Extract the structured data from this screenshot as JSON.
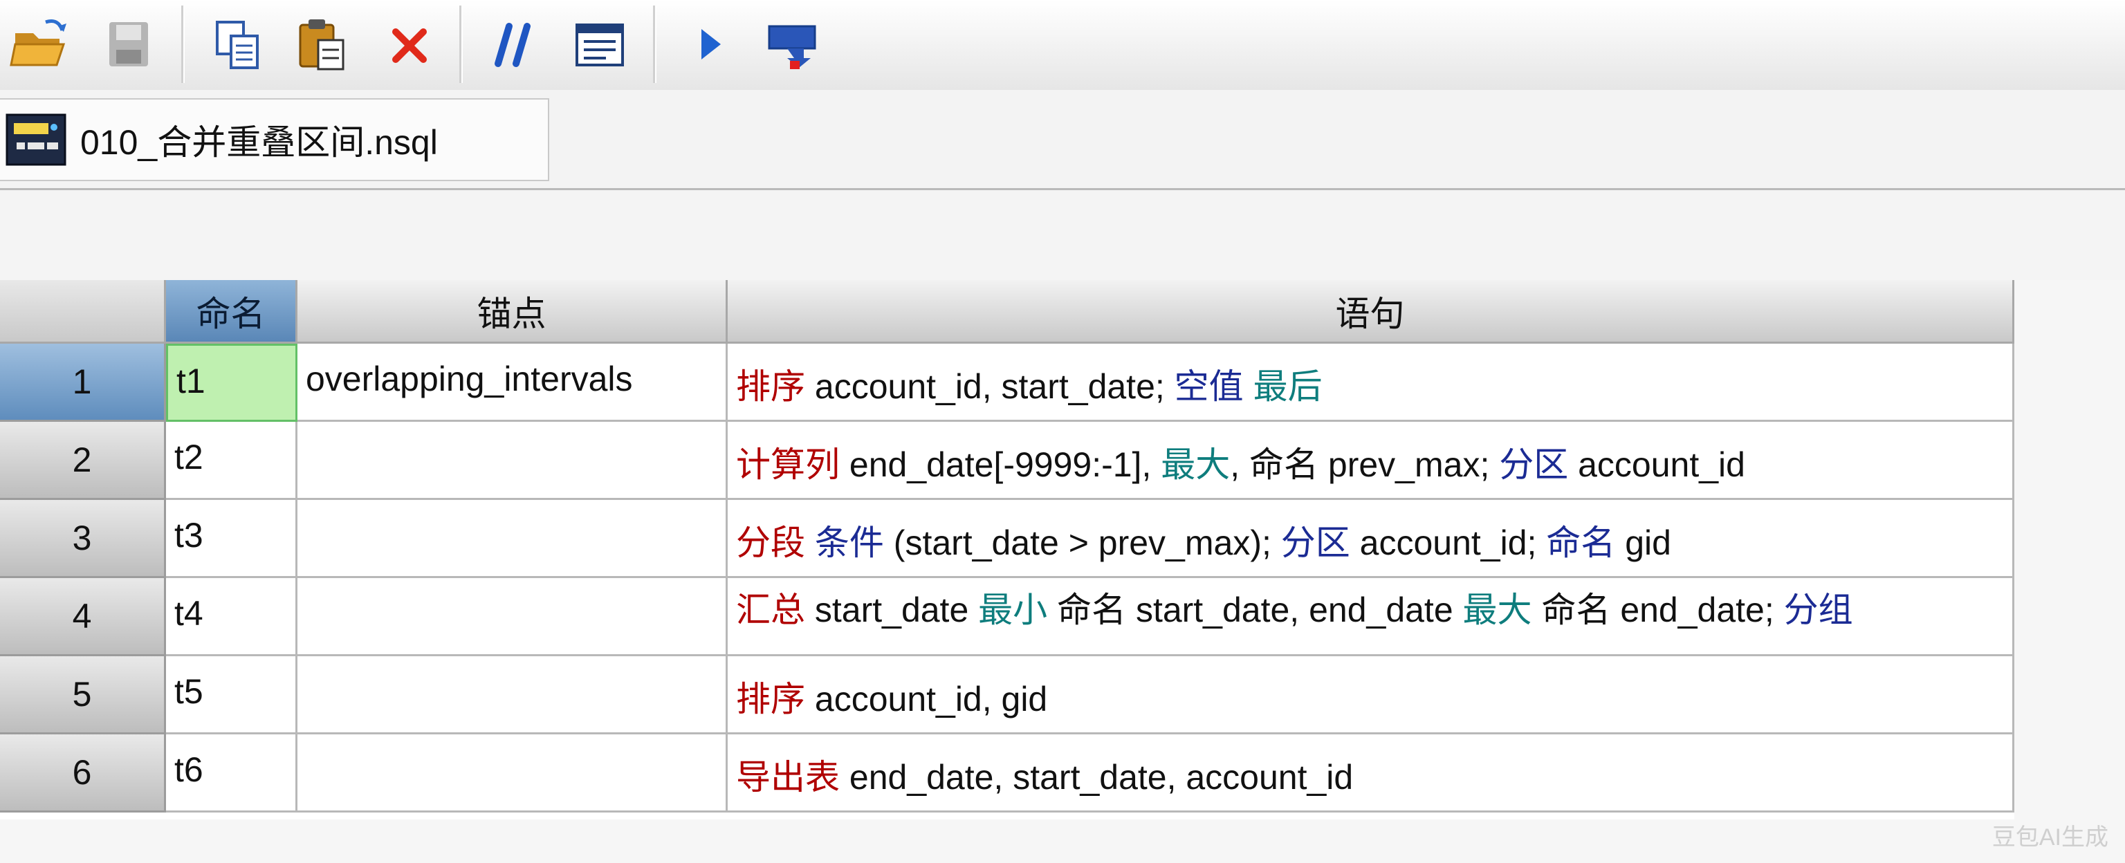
{
  "toolbar": {
    "buttons": [
      {
        "name": "open-folder-icon"
      },
      {
        "name": "save-icon"
      },
      {
        "name": "copy-icon"
      },
      {
        "name": "paste-icon"
      },
      {
        "name": "delete-icon"
      },
      {
        "name": "comment-icon"
      },
      {
        "name": "properties-icon"
      },
      {
        "name": "run-icon"
      },
      {
        "name": "step-run-icon"
      }
    ]
  },
  "tab": {
    "title": "010_合并重叠区间.nsql"
  },
  "grid": {
    "headers": {
      "name": "命名",
      "anchor": "锚点",
      "statement": "语句"
    },
    "rows": [
      {
        "num": "1",
        "name": "t1",
        "anchor": "overlapping_intervals",
        "statement": [
          {
            "t": "排序",
            "c": "red"
          },
          {
            "t": " account_id, start_date; ",
            "c": "plain"
          },
          {
            "t": "空值",
            "c": "blue"
          },
          {
            "t": " ",
            "c": "plain"
          },
          {
            "t": "最后",
            "c": "teal"
          }
        ]
      },
      {
        "num": "2",
        "name": "t2",
        "anchor": "",
        "statement": [
          {
            "t": "计算列",
            "c": "red"
          },
          {
            "t": " end_date[-9999:-1], ",
            "c": "plain"
          },
          {
            "t": "最大",
            "c": "teal"
          },
          {
            "t": ", 命名 prev_max; ",
            "c": "plain"
          },
          {
            "t": "分区",
            "c": "blue"
          },
          {
            "t": " account_id",
            "c": "plain"
          }
        ]
      },
      {
        "num": "3",
        "name": "t3",
        "anchor": "",
        "statement": [
          {
            "t": "分段",
            "c": "red"
          },
          {
            "t": " ",
            "c": "plain"
          },
          {
            "t": "条件",
            "c": "blue"
          },
          {
            "t": " (start_date > prev_max); ",
            "c": "plain"
          },
          {
            "t": "分区",
            "c": "blue"
          },
          {
            "t": " account_id; ",
            "c": "plain"
          },
          {
            "t": "命名",
            "c": "blue"
          },
          {
            "t": " gid",
            "c": "plain"
          }
        ]
      },
      {
        "num": "4",
        "name": "t4",
        "anchor": "",
        "statement": [
          {
            "t": "汇总",
            "c": "red"
          },
          {
            "t": " start_date ",
            "c": "plain"
          },
          {
            "t": "最小",
            "c": "teal"
          },
          {
            "t": " 命名 start_date, end_date ",
            "c": "plain"
          },
          {
            "t": "最大",
            "c": "teal"
          },
          {
            "t": " 命名 end_date; ",
            "c": "plain"
          },
          {
            "t": "分组",
            "c": "blue"
          }
        ]
      },
      {
        "num": "5",
        "name": "t5",
        "anchor": "",
        "statement": [
          {
            "t": "排序",
            "c": "red"
          },
          {
            "t": " account_id, gid",
            "c": "plain"
          }
        ]
      },
      {
        "num": "6",
        "name": "t6",
        "anchor": "",
        "statement": [
          {
            "t": "导出表",
            "c": "red"
          },
          {
            "t": " end_date, start_date, account_id",
            "c": "plain"
          }
        ]
      }
    ],
    "selected_row": 1
  },
  "watermark": "豆包AI生成",
  "colors": {
    "keyword_red": "#b00000",
    "keyword_blue": "#1b2b94",
    "keyword_teal": "#0e7d7d",
    "selected_cell": "#bff0b0"
  }
}
